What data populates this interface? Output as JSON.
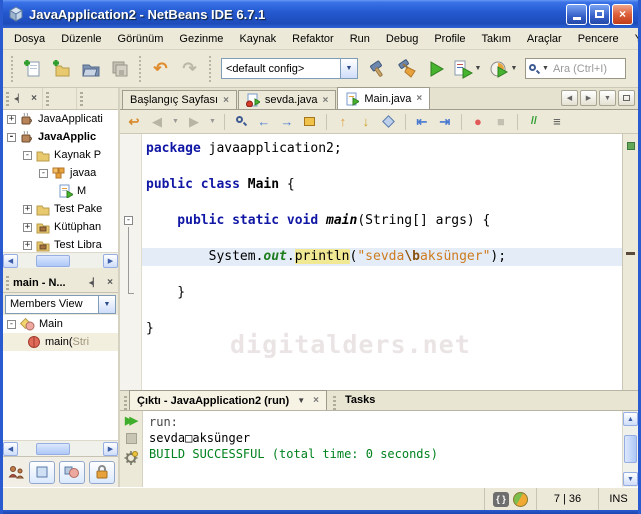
{
  "window": {
    "title": "JavaApplication2 - NetBeans IDE 6.7.1"
  },
  "menu": {
    "items": [
      "Dosya",
      "Düzenle",
      "Görünüm",
      "Gezinme",
      "Kaynak",
      "Refaktor",
      "Run",
      "Debug",
      "Profile",
      "Takım",
      "Araçlar",
      "Pencere",
      "Yardım"
    ]
  },
  "toolbar": {
    "config_value": "<default config>",
    "search_placeholder": "Ara (Ctrl+I)"
  },
  "editor_tabs": {
    "tab1": "Başlangıç Sayfası",
    "tab2": "sevda.java",
    "tab3": "Main.java"
  },
  "projects": {
    "items": [
      "JavaApplicati",
      "JavaApplic",
      "Kaynak P",
      "javaa",
      "M",
      "Test Pake",
      "Kütüphan",
      "Test Libra"
    ]
  },
  "navigator": {
    "title": "main - N...",
    "view": "Members View",
    "class_label": "Main",
    "method_label": "main(",
    "method_params": "Stri"
  },
  "code": {
    "l1_kw": "package",
    "l1_plain": " javaapplication2;",
    "l3_kw": "public class ",
    "l3_name": "Main",
    "l3_plain": " {",
    "l5_kw": "    public static void ",
    "l5_name": "main",
    "l5_plain": "(String[] args) {",
    "l7_plain1": "        System.",
    "l7_field": "out",
    "l7_dot": ".",
    "l7_method": "println",
    "l7_open": "(",
    "l7_str1": "\"sevda",
    "l7_esc": "\\b",
    "l7_str2": "aksünger\"",
    "l7_close": ");",
    "l9": "    }",
    "l11": "}"
  },
  "watermark": "digitalders.net",
  "output": {
    "tab": "Çıktı - JavaApplication2 (run)",
    "tasks": "Tasks",
    "line1": "run:",
    "line2": "sevda□aksünger",
    "line3": "BUILD SUCCESSFUL (total time: 0 seconds)"
  },
  "status": {
    "position": "7 | 36",
    "mode": "INS"
  },
  "icons": {
    "undo": "↶",
    "redo": "↷",
    "dropdown": "▼",
    "back": "◀",
    "forward": "▶",
    "close": "×",
    "record": "●",
    "stop": "■",
    "run": "▶",
    "prev_occ": "←",
    "next_occ": "→",
    "up": "↑",
    "down": "↓",
    "shift_left": "⇤",
    "shift_right": "⇥",
    "comment": "//",
    "uncomment": "≡",
    "last_edit": "↩",
    "scroll_up": "▲",
    "scroll_down": "▼",
    "scroll_left": "◀",
    "scroll_right": "▶",
    "minimize_pane": "◂▏",
    "maximize_pane": "▭"
  }
}
